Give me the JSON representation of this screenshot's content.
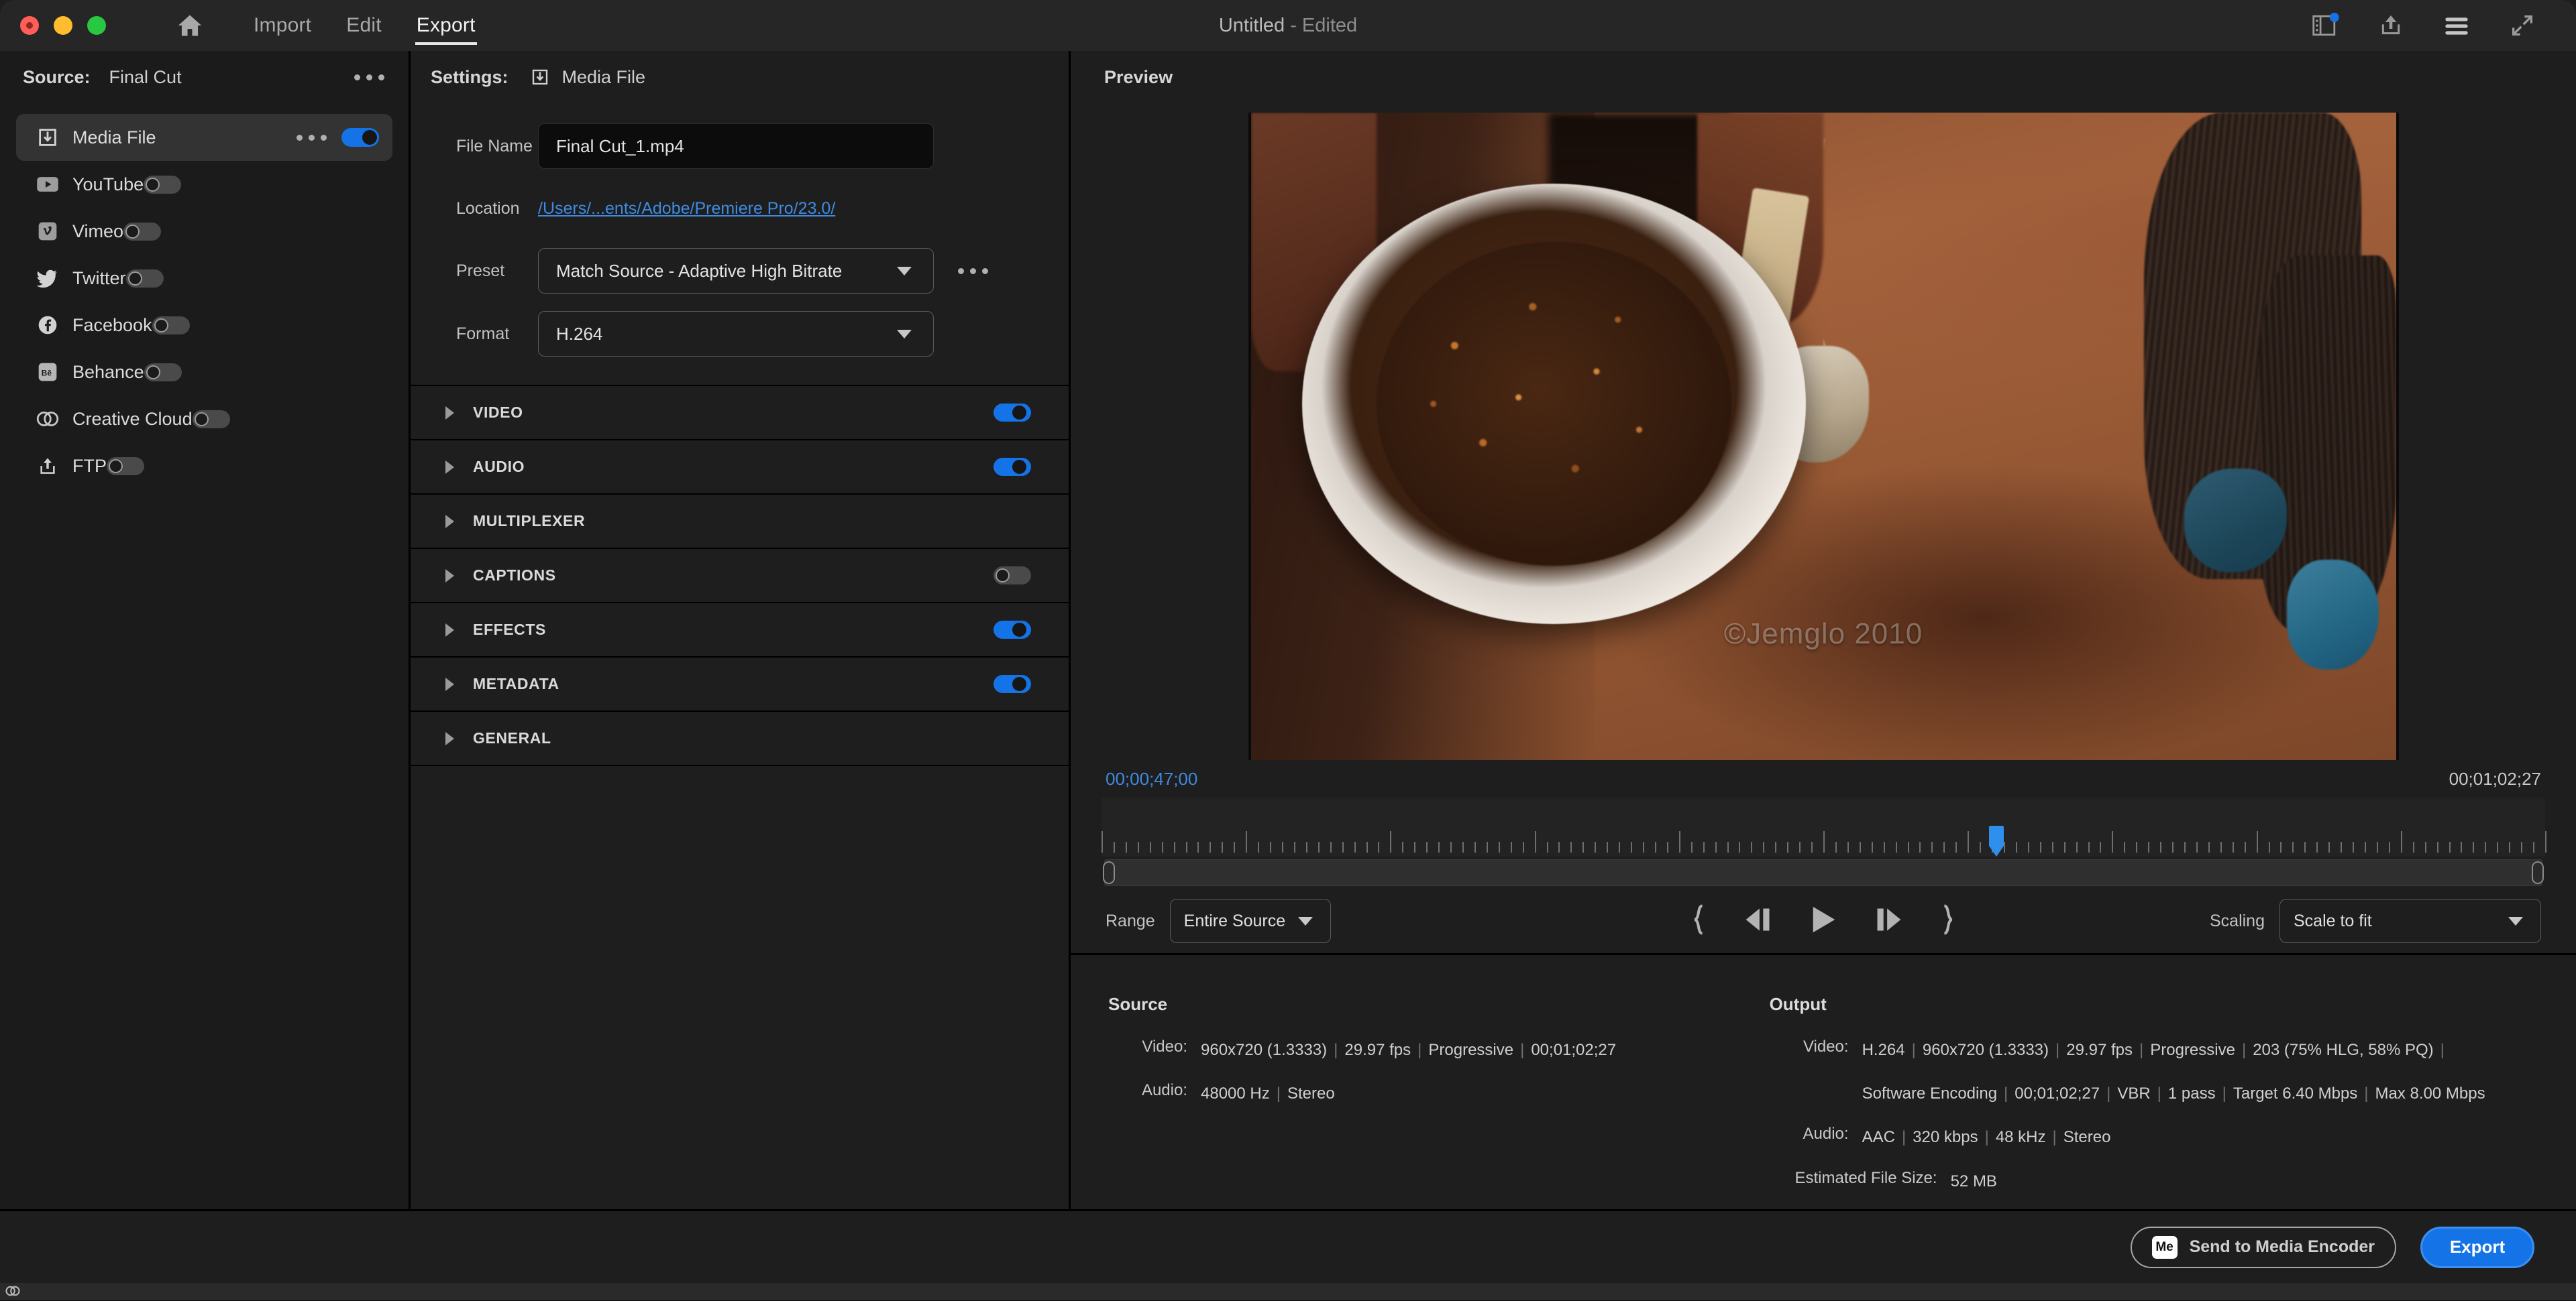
{
  "titlebar": {
    "nav": [
      {
        "label": "Import",
        "active": false
      },
      {
        "label": "Edit",
        "active": false
      },
      {
        "label": "Export",
        "active": true
      }
    ],
    "home_icon": "home-icon",
    "title": "Untitled",
    "title_suffix": "- Edited",
    "right_icons": [
      "notifications-icon",
      "share-icon",
      "menu-icon",
      "fullscreen-icon"
    ]
  },
  "sidebar": {
    "header_label": "Source:",
    "header_value": "Final Cut",
    "items": [
      {
        "label": "Media File",
        "icon": "media-file-icon",
        "enabled": true,
        "selected": true,
        "has_dots": true
      },
      {
        "label": "YouTube",
        "icon": "youtube-icon",
        "enabled": false,
        "selected": false,
        "has_dots": false
      },
      {
        "label": "Vimeo",
        "icon": "vimeo-icon",
        "enabled": false,
        "selected": false,
        "has_dots": false
      },
      {
        "label": "Twitter",
        "icon": "twitter-icon",
        "enabled": false,
        "selected": false,
        "has_dots": false
      },
      {
        "label": "Facebook",
        "icon": "facebook-icon",
        "enabled": false,
        "selected": false,
        "has_dots": false
      },
      {
        "label": "Behance",
        "icon": "behance-icon",
        "enabled": false,
        "selected": false,
        "has_dots": false
      },
      {
        "label": "Creative Cloud",
        "icon": "creative-cloud-icon",
        "enabled": false,
        "selected": false,
        "has_dots": false
      },
      {
        "label": "FTP",
        "icon": "ftp-icon",
        "enabled": false,
        "selected": false,
        "has_dots": false
      }
    ]
  },
  "settings": {
    "header_label": "Settings:",
    "header_value": "Media File",
    "fields": {
      "file_name_label": "File Name",
      "file_name_value": "Final Cut_1.mp4",
      "location_label": "Location",
      "location_value": "/Users/...ents/Adobe/Premiere Pro/23.0/",
      "preset_label": "Preset",
      "preset_value": "Match Source - Adaptive High Bitrate",
      "format_label": "Format",
      "format_value": "H.264"
    },
    "sections": [
      {
        "label": "VIDEO",
        "toggle": "on"
      },
      {
        "label": "AUDIO",
        "toggle": "on"
      },
      {
        "label": "MULTIPLEXER",
        "toggle": "none"
      },
      {
        "label": "CAPTIONS",
        "toggle": "off"
      },
      {
        "label": "EFFECTS",
        "toggle": "on"
      },
      {
        "label": "METADATA",
        "toggle": "on"
      },
      {
        "label": "GENERAL",
        "toggle": "none"
      }
    ]
  },
  "preview": {
    "header_label": "Preview",
    "watermark": "©Jemglo 2010",
    "timecode_in": "00;00;47;00",
    "timecode_out": "00;01;02;27",
    "playhead_percent": 62,
    "range_label": "Range",
    "range_value": "Entire Source",
    "scaling_label": "Scaling",
    "scaling_value": "Scale to fit",
    "transport": [
      "mark-in-icon",
      "step-back-icon",
      "play-icon",
      "step-forward-icon",
      "mark-out-icon"
    ]
  },
  "info": {
    "source_title": "Source",
    "source_rows": [
      {
        "key": "Video:",
        "parts": [
          "960x720 (1.3333)",
          "29.97 fps",
          "Progressive",
          "00;01;02;27"
        ]
      },
      {
        "key": "Audio:",
        "parts": [
          "48000 Hz",
          "Stereo"
        ]
      }
    ],
    "output_title": "Output",
    "output_rows": [
      {
        "key": "Video:",
        "parts": [
          "H.264",
          "960x720 (1.3333)",
          "29.97 fps",
          "Progressive",
          "203 (75% HLG, 58% PQ)"
        ]
      },
      {
        "key": "",
        "parts": [
          "Software Encoding",
          "00;01;02;27",
          "VBR",
          "1 pass",
          "Target 6.40 Mbps",
          "Max 8.00 Mbps"
        ]
      },
      {
        "key": "Audio:",
        "parts": [
          "AAC",
          "320 kbps",
          "48 kHz",
          "Stereo"
        ]
      }
    ],
    "file_size_label": "Estimated File Size:",
    "file_size_value": "52 MB"
  },
  "footer": {
    "media_encoder_badge": "Me",
    "media_encoder_label": "Send to Media Encoder",
    "export_label": "Export"
  },
  "colors": {
    "accent_blue": "#1473e6",
    "link_blue": "#3f8ae0",
    "panel_bg": "#1e1e1e",
    "sidebar_bg": "#1b1b1b",
    "titlebar_bg": "#262626",
    "selected_row": "#333333"
  }
}
